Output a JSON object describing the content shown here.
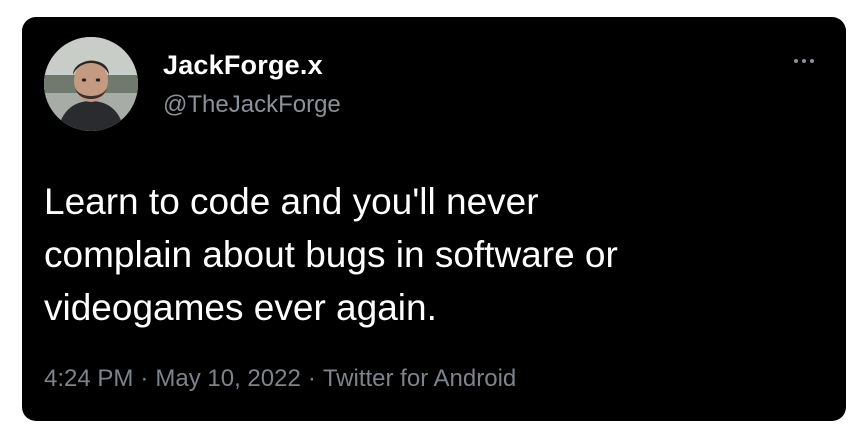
{
  "colors": {
    "card_background": "#000000",
    "page_background": "#ffffff",
    "primary_text": "#ffffff",
    "secondary_text": "#8b9199"
  },
  "author": {
    "display_name": "JackForge.x",
    "handle": "@TheJackForge",
    "avatar_icon": "profile-photo-icon"
  },
  "more_menu": {
    "icon": "more-horizontal-icon"
  },
  "tweet": {
    "text_lines": [
      "Learn to code and you'll never",
      "complain about bugs in software or",
      "videogames ever again."
    ]
  },
  "meta": {
    "time": "4:24 PM",
    "separator": "·",
    "date": "May 10, 2022",
    "source": "Twitter for Android"
  }
}
